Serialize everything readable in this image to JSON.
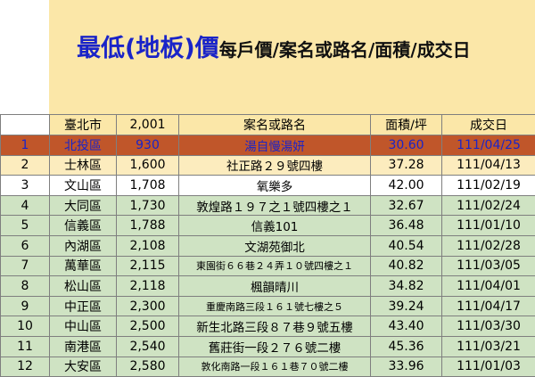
{
  "title": {
    "main": "最低(地板)價",
    "sub": "每戶價/案名或路名/面積/成交日"
  },
  "header": {
    "city": "臺北市",
    "price": "2,001",
    "name": "案名或路名",
    "area": "面積/坪",
    "date": "成交日"
  },
  "rows": [
    {
      "idx": "1",
      "district": "北投區",
      "price": "930",
      "name": "湯自慢湯妍",
      "area": "30.60",
      "date": "111/04/25"
    },
    {
      "idx": "2",
      "district": "士林區",
      "price": "1,600",
      "name": "社正路２９號四樓",
      "area": "37.28",
      "date": "111/04/13"
    },
    {
      "idx": "3",
      "district": "文山區",
      "price": "1,708",
      "name": "氧樂多",
      "area": "42.00",
      "date": "111/02/19"
    },
    {
      "idx": "4",
      "district": "大同區",
      "price": "1,730",
      "name": "敦煌路１９７之１號四樓之１",
      "area": "32.67",
      "date": "111/02/24"
    },
    {
      "idx": "5",
      "district": "信義區",
      "price": "1,788",
      "name": "信義101",
      "area": "36.48",
      "date": "111/01/10"
    },
    {
      "idx": "6",
      "district": "內湖區",
      "price": "2,108",
      "name": "文湖苑御北",
      "area": "40.54",
      "date": "111/02/28"
    },
    {
      "idx": "7",
      "district": "萬華區",
      "price": "2,115",
      "name": "東園街６６巷２４弄１０號四樓之１",
      "area": "40.82",
      "date": "111/03/05"
    },
    {
      "idx": "8",
      "district": "松山區",
      "price": "2,118",
      "name": "楓韻晴川",
      "area": "34.82",
      "date": "111/04/01"
    },
    {
      "idx": "9",
      "district": "中正區",
      "price": "2,300",
      "name": "重慶南路三段１６１號七樓之５",
      "area": "39.24",
      "date": "111/04/17"
    },
    {
      "idx": "10",
      "district": "中山區",
      "price": "2,500",
      "name": "新生北路三段８７巷９號五樓",
      "area": "43.40",
      "date": "111/03/30"
    },
    {
      "idx": "11",
      "district": "南港區",
      "price": "2,540",
      "name": "舊莊街一段２７６號二樓",
      "area": "45.36",
      "date": "111/03/21"
    },
    {
      "idx": "12",
      "district": "大安區",
      "price": "2,580",
      "name": "敦化南路一段１６１巷７０號二樓",
      "area": "33.96",
      "date": "111/01/03"
    }
  ]
}
